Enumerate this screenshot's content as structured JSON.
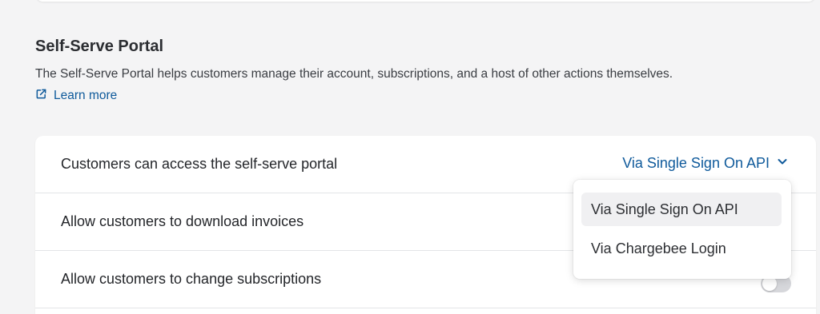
{
  "section": {
    "title": "Self-Serve Portal",
    "description": "The Self-Serve Portal helps customers manage their account, subscriptions, and a host of other actions themselves.",
    "learn_more": "Learn more"
  },
  "settings": {
    "access_label": "Customers can access the self-serve portal",
    "access_value": "Via Single Sign On API",
    "download_invoices_label": "Allow customers to download invoices",
    "change_subscriptions_label": "Allow customers to change subscriptions",
    "change_subscriptions_enabled": false
  },
  "dropdown": {
    "options": [
      {
        "label": "Via Single Sign On API",
        "selected": true
      },
      {
        "label": "Via Chargebee Login",
        "selected": false
      }
    ]
  },
  "icons": {
    "learn_more": "external-link-icon",
    "select": "chevron-down-icon"
  },
  "colors": {
    "accent": "#0f5a9b",
    "background": "#f4f4f5",
    "card": "#ffffff",
    "toggle_off": "#d6d7db"
  }
}
